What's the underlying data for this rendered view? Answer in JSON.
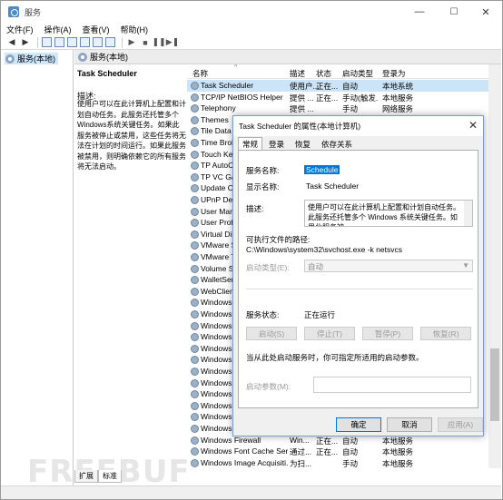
{
  "window": {
    "title": "服务",
    "min": "—",
    "max": "☐",
    "close": "✕"
  },
  "menu": [
    "文件(F)",
    "操作(A)",
    "查看(V)",
    "帮助(H)"
  ],
  "tree": {
    "item": "服务(本地)"
  },
  "header": {
    "title": "服务(本地)"
  },
  "detail": {
    "name": "Task Scheduler",
    "desc_label": "描述:",
    "desc_text": "使用户可以在此计算机上配置和计划自动任务。此服务还托管多个Windows系统关键任务。如果此服务被停止或禁用，这些任务将无法在计划的时间运行。如果此服务被禁用，则明确依赖它的所有服务将无法启动。"
  },
  "columns": {
    "name": "名称",
    "desc": "描述",
    "status": "状态",
    "startup": "启动类型",
    "logon": "登录为"
  },
  "rows": [
    {
      "name": "Task Scheduler",
      "desc": "使用户...",
      "status": "正在...",
      "startup": "自动",
      "logon": "本地系统"
    },
    {
      "name": "TCP/IP NetBIOS Helper",
      "desc": "提供 ...",
      "status": "正在...",
      "startup": "手动(触发...",
      "logon": "本地服务"
    },
    {
      "name": "Telephony",
      "desc": "提供 ...",
      "status": "",
      "startup": "手动",
      "logon": "网络服务"
    },
    {
      "name": "Themes",
      "desc": "",
      "status": "",
      "startup": "",
      "logon": ""
    },
    {
      "name": "Tile Data m",
      "desc": "",
      "status": "",
      "startup": "",
      "logon": ""
    },
    {
      "name": "Time Broker",
      "desc": "",
      "status": "",
      "startup": "",
      "logon": ""
    },
    {
      "name": "Touch Keyb",
      "desc": "",
      "status": "",
      "startup": "",
      "logon": ""
    },
    {
      "name": "TP AutoCon",
      "desc": "",
      "status": "",
      "startup": "",
      "logon": ""
    },
    {
      "name": "TP VC Gate",
      "desc": "",
      "status": "",
      "startup": "",
      "logon": ""
    },
    {
      "name": "Update Orc",
      "desc": "",
      "status": "",
      "startup": "",
      "logon": ""
    },
    {
      "name": "UPnP Devic",
      "desc": "",
      "status": "",
      "startup": "",
      "logon": ""
    },
    {
      "name": "User Mana",
      "desc": "",
      "status": "",
      "startup": "",
      "logon": ""
    },
    {
      "name": "User Profil",
      "desc": "",
      "status": "",
      "startup": "",
      "logon": ""
    },
    {
      "name": "Virtual Disk",
      "desc": "",
      "status": "",
      "startup": "",
      "logon": ""
    },
    {
      "name": "VMware Sna",
      "desc": "",
      "status": "",
      "startup": "",
      "logon": ""
    },
    {
      "name": "VMware To",
      "desc": "",
      "status": "",
      "startup": "",
      "logon": ""
    },
    {
      "name": "Volume Sha",
      "desc": "",
      "status": "",
      "startup": "",
      "logon": ""
    },
    {
      "name": "WalletServi",
      "desc": "",
      "status": "",
      "startup": "",
      "logon": ""
    },
    {
      "name": "WebClient",
      "desc": "",
      "status": "",
      "startup": "",
      "logon": ""
    },
    {
      "name": "Windows A",
      "desc": "",
      "status": "",
      "startup": "",
      "logon": ""
    },
    {
      "name": "Windows A",
      "desc": "",
      "status": "",
      "startup": "",
      "logon": ""
    },
    {
      "name": "Windows A",
      "desc": "",
      "status": "",
      "startup": "",
      "logon": ""
    },
    {
      "name": "Windows B",
      "desc": "",
      "status": "",
      "startup": "",
      "logon": ""
    },
    {
      "name": "Windows B",
      "desc": "",
      "status": "",
      "startup": "",
      "logon": ""
    },
    {
      "name": "Windows C",
      "desc": "",
      "status": "",
      "startup": "",
      "logon": ""
    },
    {
      "name": "Windows C",
      "desc": "",
      "status": "",
      "startup": "",
      "logon": ""
    },
    {
      "name": "Windows C",
      "desc": "",
      "status": "",
      "startup": "",
      "logon": ""
    },
    {
      "name": "Windows D",
      "desc": "",
      "status": "",
      "startup": "",
      "logon": ""
    },
    {
      "name": "Windows D",
      "desc": "",
      "status": "",
      "startup": "",
      "logon": ""
    },
    {
      "name": "Windows E",
      "desc": "",
      "status": "",
      "startup": "",
      "logon": ""
    },
    {
      "name": "Windows Event Log",
      "desc": "此服务...",
      "status": "正在...",
      "startup": "自动",
      "logon": "本地服务"
    },
    {
      "name": "Windows Firewall",
      "desc": "Win...",
      "status": "正在...",
      "startup": "自动",
      "logon": "本地服务"
    },
    {
      "name": "Windows Font Cache Ser...",
      "desc": "通过...",
      "status": "正在...",
      "startup": "自动",
      "logon": "本地服务"
    },
    {
      "name": "Windows Image Acquisiti...",
      "desc": "为扫...",
      "status": "",
      "startup": "手动",
      "logon": "本地服务"
    }
  ],
  "tabs": [
    "扩展",
    "标准"
  ],
  "watermark": "FREEBUF",
  "dialog": {
    "title": "Task Scheduler 的属性(本地计算机)",
    "close": "✕",
    "tabs": [
      "常规",
      "登录",
      "恢复",
      "依存关系"
    ],
    "service_name_label": "服务名称:",
    "service_name": "Schedule",
    "display_name_label": "显示名称:",
    "display_name": "Task Scheduler",
    "desc_label": "描述:",
    "desc_value": "使用户可以在此计算机上配置和计划自动任务。此服务还托管多个 Windows 系统关键任务。如果此服务被",
    "path_label": "可执行文件的路径:",
    "path_value": "C:\\Windows\\system32\\svchost.exe -k netsvcs",
    "startup_label": "启动类型(E):",
    "startup_value": "自动",
    "status_label": "服务状态:",
    "status_value": "正在运行",
    "btn_start": "启动(S)",
    "btn_stop": "停止(T)",
    "btn_pause": "暂停(P)",
    "btn_resume": "恢复(R)",
    "hint": "当从此处启动服务时，你可指定所适用的启动参数。",
    "param_label": "启动参数(M):",
    "ok": "确定",
    "cancel": "取消",
    "apply": "应用(A)"
  }
}
